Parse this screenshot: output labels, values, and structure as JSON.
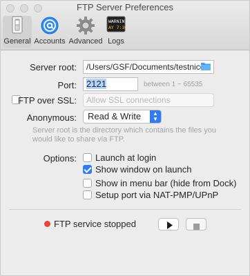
{
  "window": {
    "title": "FTP Server Preferences"
  },
  "toolbar": {
    "items": [
      {
        "label": "General",
        "icon": "switch-icon",
        "selected": true
      },
      {
        "label": "Accounts",
        "icon": "at-sign-icon",
        "selected": false
      },
      {
        "label": "Advanced",
        "icon": "gear-icon",
        "selected": false
      },
      {
        "label": "Logs",
        "icon": "console-icon",
        "selected": false
      }
    ],
    "logs_icon_text": "WARNIN AY 7:36"
  },
  "general": {
    "server_root_label": "Server root:",
    "server_root_value": "/Users/GSF/Documents/testnico",
    "port_label": "Port:",
    "port_value": "2121",
    "port_hint": "between 1 ~ 65535",
    "ftp_over_ssl_label": "FTP over SSL:",
    "ftp_over_ssl_checked": false,
    "ssl_popup_value": "Allow SSL connections",
    "anonymous_label": "Anonymous:",
    "anonymous_value": "Read & Write",
    "description": "Server root is the directory which contains the files you would like to share via FTP.",
    "options_label": "Options:",
    "options": [
      {
        "label": "Launch at login",
        "checked": false
      },
      {
        "label": "Show window on launch",
        "checked": true
      },
      {
        "label": "Show in menu bar (hide from Dock)",
        "checked": false
      },
      {
        "label": "Setup port via NAT-PMP/UPnP",
        "checked": false
      }
    ]
  },
  "status": {
    "text": "FTP service stopped",
    "color": "#e8453c",
    "start_icon": "play-icon",
    "stop_icon": "stop-icon"
  },
  "colors": {
    "accent": "#2f7bf5",
    "folder": "#3d9cf5"
  }
}
